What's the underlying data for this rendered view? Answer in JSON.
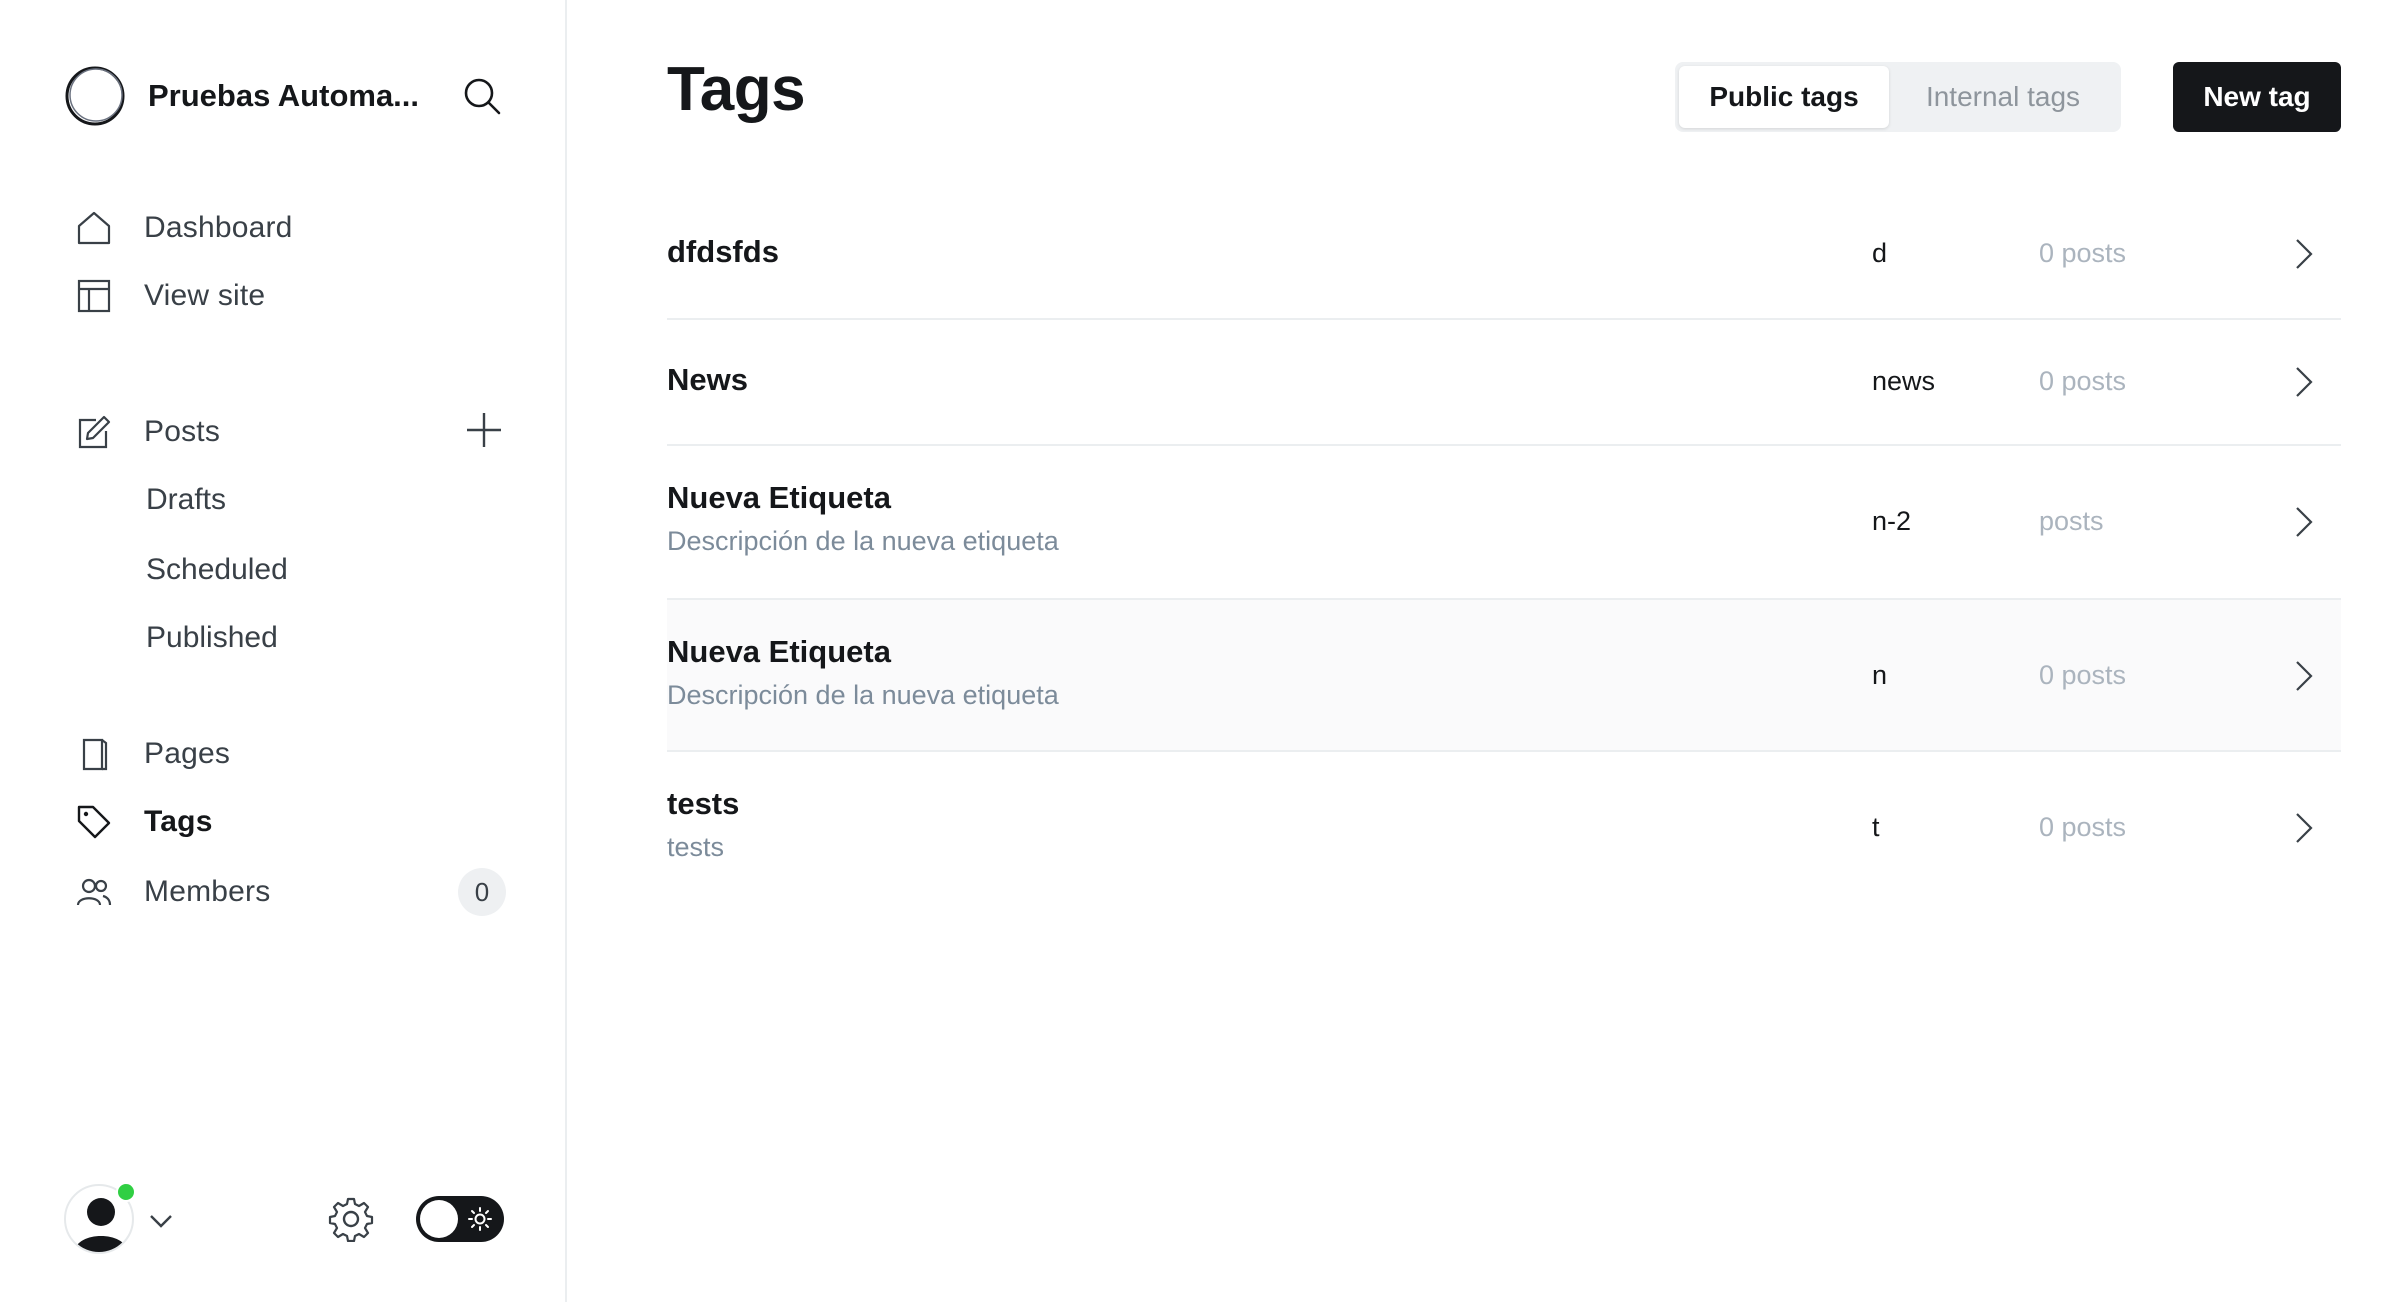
{
  "site": {
    "title": "Pruebas Automa..."
  },
  "nav": {
    "dashboard": "Dashboard",
    "view_site": "View site",
    "posts": "Posts",
    "drafts": "Drafts",
    "scheduled": "Scheduled",
    "published": "Published",
    "pages": "Pages",
    "tags": "Tags",
    "members": "Members",
    "members_count": "0"
  },
  "header": {
    "title": "Tags",
    "tabs": [
      {
        "label": "Public tags",
        "active": true
      },
      {
        "label": "Internal tags",
        "active": false
      }
    ],
    "new_button": "New tag"
  },
  "tags": [
    {
      "name": "dfdsfds",
      "description": "",
      "slug": "d",
      "count": "0 posts"
    },
    {
      "name": "News",
      "description": "",
      "slug": "news",
      "count": "0 posts"
    },
    {
      "name": "Nueva Etiqueta",
      "description": "Descripción de la nueva etiqueta",
      "slug": "n-2",
      "count": "posts"
    },
    {
      "name": "Nueva Etiqueta",
      "description": "Descripción de la nueva etiqueta",
      "slug": "n",
      "count": "0 posts"
    },
    {
      "name": "tests",
      "description": "tests",
      "slug": "t",
      "count": "0 posts"
    }
  ],
  "colors": {
    "accent": "#15171a",
    "online": "#30cf43",
    "muted": "#7c8b9a"
  }
}
